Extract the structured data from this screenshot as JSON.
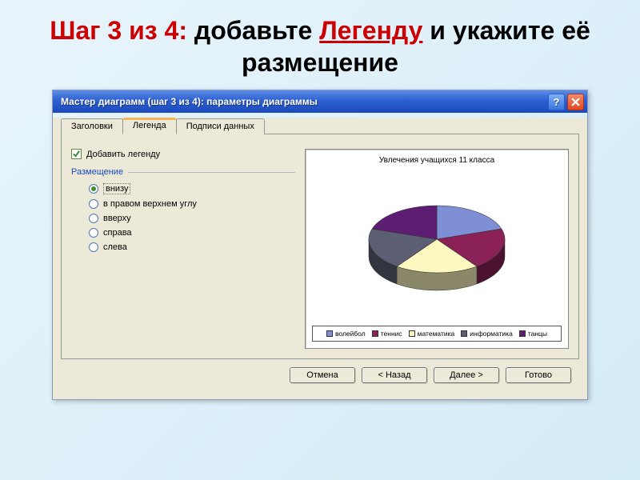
{
  "slide": {
    "step": "Шаг 3 из 4:",
    "add": " добавьте ",
    "legend": "Легенду",
    "and_place": " и укажите её размещение"
  },
  "titlebar": {
    "text": "Мастер диаграмм (шаг 3 из 4): параметры диаграммы",
    "help": "?"
  },
  "tabs": {
    "headers": "Заголовки",
    "legend": "Легенда",
    "datalabels": "Подписи данных"
  },
  "checkbox": {
    "label": "Добавить легенду",
    "checked": true
  },
  "group": {
    "title": "Размещение"
  },
  "radios": {
    "bottom": "внизу",
    "topright": "в правом верхнем углу",
    "top": "вверху",
    "right": "справа",
    "left": "слева",
    "selected": "bottom"
  },
  "preview": {
    "title": "Увлечения учащихся 11 класса"
  },
  "chart_data": {
    "type": "pie",
    "title": "Увлечения учащихся 11 класса",
    "categories": [
      "волейбол",
      "теннис",
      "математика",
      "информатика",
      "танцы"
    ],
    "values": [
      20,
      20,
      20,
      20,
      20
    ],
    "colors": [
      "#7e8fd6",
      "#8a2257",
      "#fdf7c0",
      "#5c5f73",
      "#5d1d72"
    ]
  },
  "buttons": {
    "cancel": "Отмена",
    "back": "< Назад",
    "next": "Далее >",
    "finish": "Готово"
  }
}
